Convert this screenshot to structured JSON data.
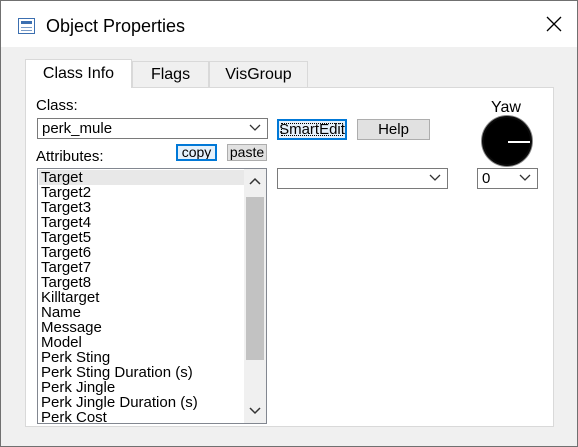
{
  "window": {
    "title": "Object Properties"
  },
  "tabs": [
    {
      "label": "Class Info"
    },
    {
      "label": "Flags"
    },
    {
      "label": "VisGroup"
    }
  ],
  "class_info": {
    "class_label": "Class:",
    "class_value": "perk_mule",
    "smartedit_label": "SmartEdit",
    "help_label": "Help",
    "attributes_label": "Attributes:",
    "copy_label": "copy",
    "paste_label": "paste",
    "attributes": [
      "Target",
      "Target2",
      "Target3",
      "Target4",
      "Target5",
      "Target6",
      "Target7",
      "Target8",
      "Killtarget",
      "Name",
      "Message",
      "Model",
      "Perk Sting",
      "Perk Sting Duration (s)",
      "Perk Jingle",
      "Perk Jingle Duration (s)",
      "Perk Cost"
    ],
    "selected_attribute": "Target",
    "value_select": "",
    "yaw_label": "Yaw",
    "yaw_value": "0",
    "yaw_angle_deg": 0
  },
  "icons": {
    "app": "properties-window-icon",
    "close": "close-icon",
    "dropdown": "chevron-down-icon",
    "scroll_up": "chevron-up-icon",
    "scroll_down": "chevron-down-icon"
  }
}
